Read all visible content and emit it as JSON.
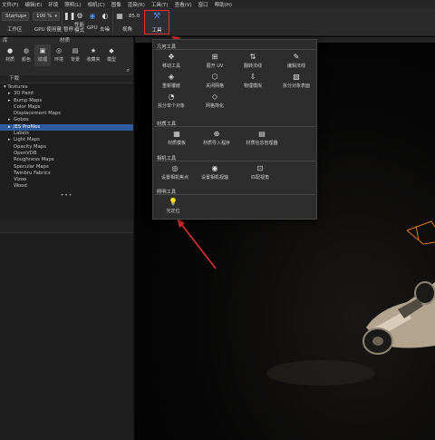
{
  "menubar": [
    "文件(F)",
    "编辑(E)",
    "环境",
    "照明(L)",
    "相机(C)",
    "图像",
    "渲染(R)",
    "工具(T)",
    "查看(V)",
    "窗口",
    "帮助(H)"
  ],
  "toolbar": {
    "workspace_value": "Startup",
    "zoom_value": "100 %",
    "workspace_label": "工作区",
    "gpu_usage_label": "GPU 使用量",
    "pause_label": "暂停",
    "performance_label": "性能\n模式",
    "gpu_label": "GPU",
    "denoise_label": "去噪",
    "fov_value": "85.0",
    "view_label": "视角",
    "tools_label": "工具"
  },
  "left_panel": {
    "header_left": "库",
    "header_right": "材质",
    "tabs": [
      {
        "label": "材质",
        "icon": "sphere-icon"
      },
      {
        "label": "颜色",
        "icon": "palette-icon"
      },
      {
        "label": "纹理",
        "icon": "texture-icon"
      },
      {
        "label": "环境",
        "icon": "globe-icon"
      },
      {
        "label": "背景",
        "icon": "image-icon"
      },
      {
        "label": "收藏夹",
        "icon": "star-icon"
      },
      {
        "label": "模型",
        "icon": "cube-icon"
      }
    ],
    "library_title": "下载",
    "tree_root": "Textures",
    "tree": [
      {
        "label": "3D Paint",
        "arrow": true,
        "selected": false
      },
      {
        "label": "Bump Maps",
        "arrow": true,
        "selected": false
      },
      {
        "label": "Color Maps",
        "arrow": false,
        "selected": false
      },
      {
        "label": "Displacement Maps",
        "arrow": false,
        "selected": false
      },
      {
        "label": "Gobos",
        "arrow": true,
        "selected": false
      },
      {
        "label": "IES Profiles",
        "arrow": true,
        "selected": true
      },
      {
        "label": "Labels",
        "arrow": false,
        "selected": false
      },
      {
        "label": "Light Maps",
        "arrow": true,
        "selected": false
      },
      {
        "label": "Opacity Maps",
        "arrow": false,
        "selected": false
      },
      {
        "label": "OpenVDB",
        "arrow": false,
        "selected": false
      },
      {
        "label": "Roughness Maps",
        "arrow": false,
        "selected": false
      },
      {
        "label": "Specular Maps",
        "arrow": false,
        "selected": false
      },
      {
        "label": "Twinbru Fabrics",
        "arrow": false,
        "selected": false
      },
      {
        "label": "Vizoo",
        "arrow": false,
        "selected": false
      },
      {
        "label": "Wood",
        "arrow": false,
        "selected": false
      }
    ],
    "splitter_dots": "•••"
  },
  "tools_menu": {
    "sections": [
      {
        "title": "几何工具",
        "items": [
          {
            "label": "移动工具",
            "icon": "move-icon"
          },
          {
            "label": "展开 UV",
            "icon": "uv-unwrap-icon"
          },
          {
            "label": "翻转法线",
            "icon": "flip-normals-icon"
          },
          {
            "label": "编辑法线",
            "icon": "edit-normals-icon"
          },
          {
            "label": "重新镶嵌",
            "icon": "retessellate-icon"
          },
          {
            "label": "关闭网格",
            "icon": "close-mesh-icon"
          },
          {
            "label": "物理模拟",
            "icon": "physics-icon"
          },
          {
            "label": "拆分对象表面",
            "icon": "split-surface-icon"
          },
          {
            "label": "拆分单个对象",
            "icon": "split-object-icon"
          },
          {
            "label": "网格简化",
            "icon": "mesh-simplify-icon"
          }
        ]
      },
      {
        "title": "材质工具",
        "items": [
          {
            "label": "材质模板",
            "icon": "material-template-icon"
          },
          {
            "label": "材质导入程序",
            "icon": "material-import-icon"
          },
          {
            "label": "材质信息管理器",
            "icon": "material-info-icon"
          }
        ]
      },
      {
        "title": "相机工具",
        "items": [
          {
            "label": "设置相机焦点",
            "icon": "camera-focus-icon"
          },
          {
            "label": "设置相机视轴",
            "icon": "camera-axis-icon"
          },
          {
            "label": "匹配视角",
            "icon": "match-perspective-icon"
          }
        ]
      },
      {
        "title": "照明工具",
        "items": [
          {
            "label": "光定位",
            "icon": "light-bulb-icon"
          }
        ]
      }
    ]
  },
  "colors": {
    "accent_blue": "#2e5a9e",
    "highlight_red": "#e03030",
    "gizmo_orange": "#e07a1a"
  }
}
